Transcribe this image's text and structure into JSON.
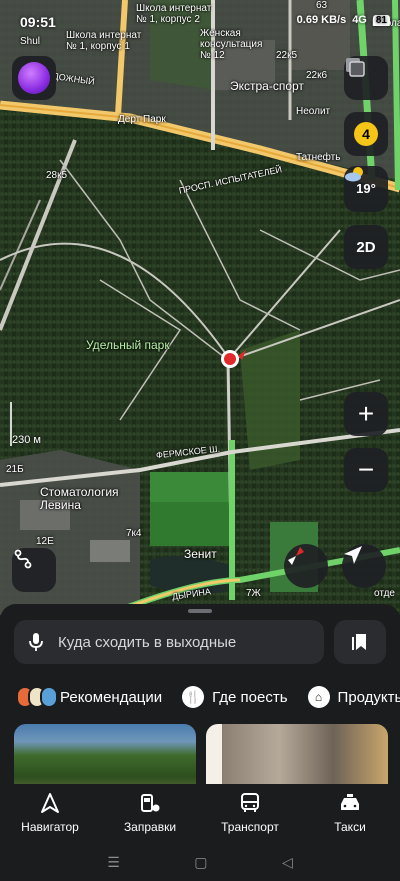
{
  "status_bar": {
    "time": "09:51",
    "network": "0.69 KB/s",
    "signal": "4G",
    "battery": "81"
  },
  "map": {
    "labels": {
      "school1": "Школа интернат\n№ 1, корпус 2",
      "school2": "Школа интернат\n№ 1, корпус 1",
      "clinic": "Женская\nконсультация\n№ 12",
      "extra_sport": "Экстра-спорт",
      "dert_park": "Дерт Парк",
      "neolit": "Неолит",
      "tatneft": "Татнефть",
      "street_ispytateley": "ПРОСП. ИСПЫТАТЕЛЕЙ",
      "street_fermskoe": "ФЕРМСКОЕ Ш.",
      "street_shuvalovskiy": "ВОДОЖНЫЙ",
      "street_lydina": "ДЫРИНА",
      "park": "Удельный парк",
      "dentistry": "Стоматология\nЛевина",
      "zenit": "Зенит",
      "b28k5": "28к5",
      "b22k5": "22к5",
      "b63": "63",
      "b22k6": "22к6",
      "b21b": "21Б",
      "b12e": "12Е",
      "b7k4": "7к4",
      "b7zh": "7Ж",
      "shuvalovo": "Shul",
      "school_right": "Школа",
      "otde": "отде"
    },
    "scale_label": "230 м",
    "traffic_level": "4",
    "weather_temp": "19°",
    "view_mode_label": "2D",
    "zoom_in": "+",
    "zoom_out": "−"
  },
  "search": {
    "placeholder": "Куда сходить в выходные"
  },
  "chips": [
    {
      "label": "Рекомендации",
      "icon": "recommendations-icon"
    },
    {
      "label": "Где поесть",
      "icon": "fork-knife-icon"
    },
    {
      "label": "Продукты",
      "icon": "basket-icon"
    }
  ],
  "bottom_nav": [
    {
      "label": "Навигатор",
      "icon": "navigator-arrow-icon"
    },
    {
      "label": "Заправки",
      "icon": "fuel-pump-icon"
    },
    {
      "label": "Транспорт",
      "icon": "bus-icon"
    },
    {
      "label": "Такси",
      "icon": "taxi-car-icon"
    }
  ],
  "colors": {
    "accent_yellow": "#f5c518",
    "sheet_bg": "#1b1c1e",
    "road_yellow": "#f2c86b",
    "road_green": "#6fd36a",
    "location_red": "#e02a2a"
  }
}
